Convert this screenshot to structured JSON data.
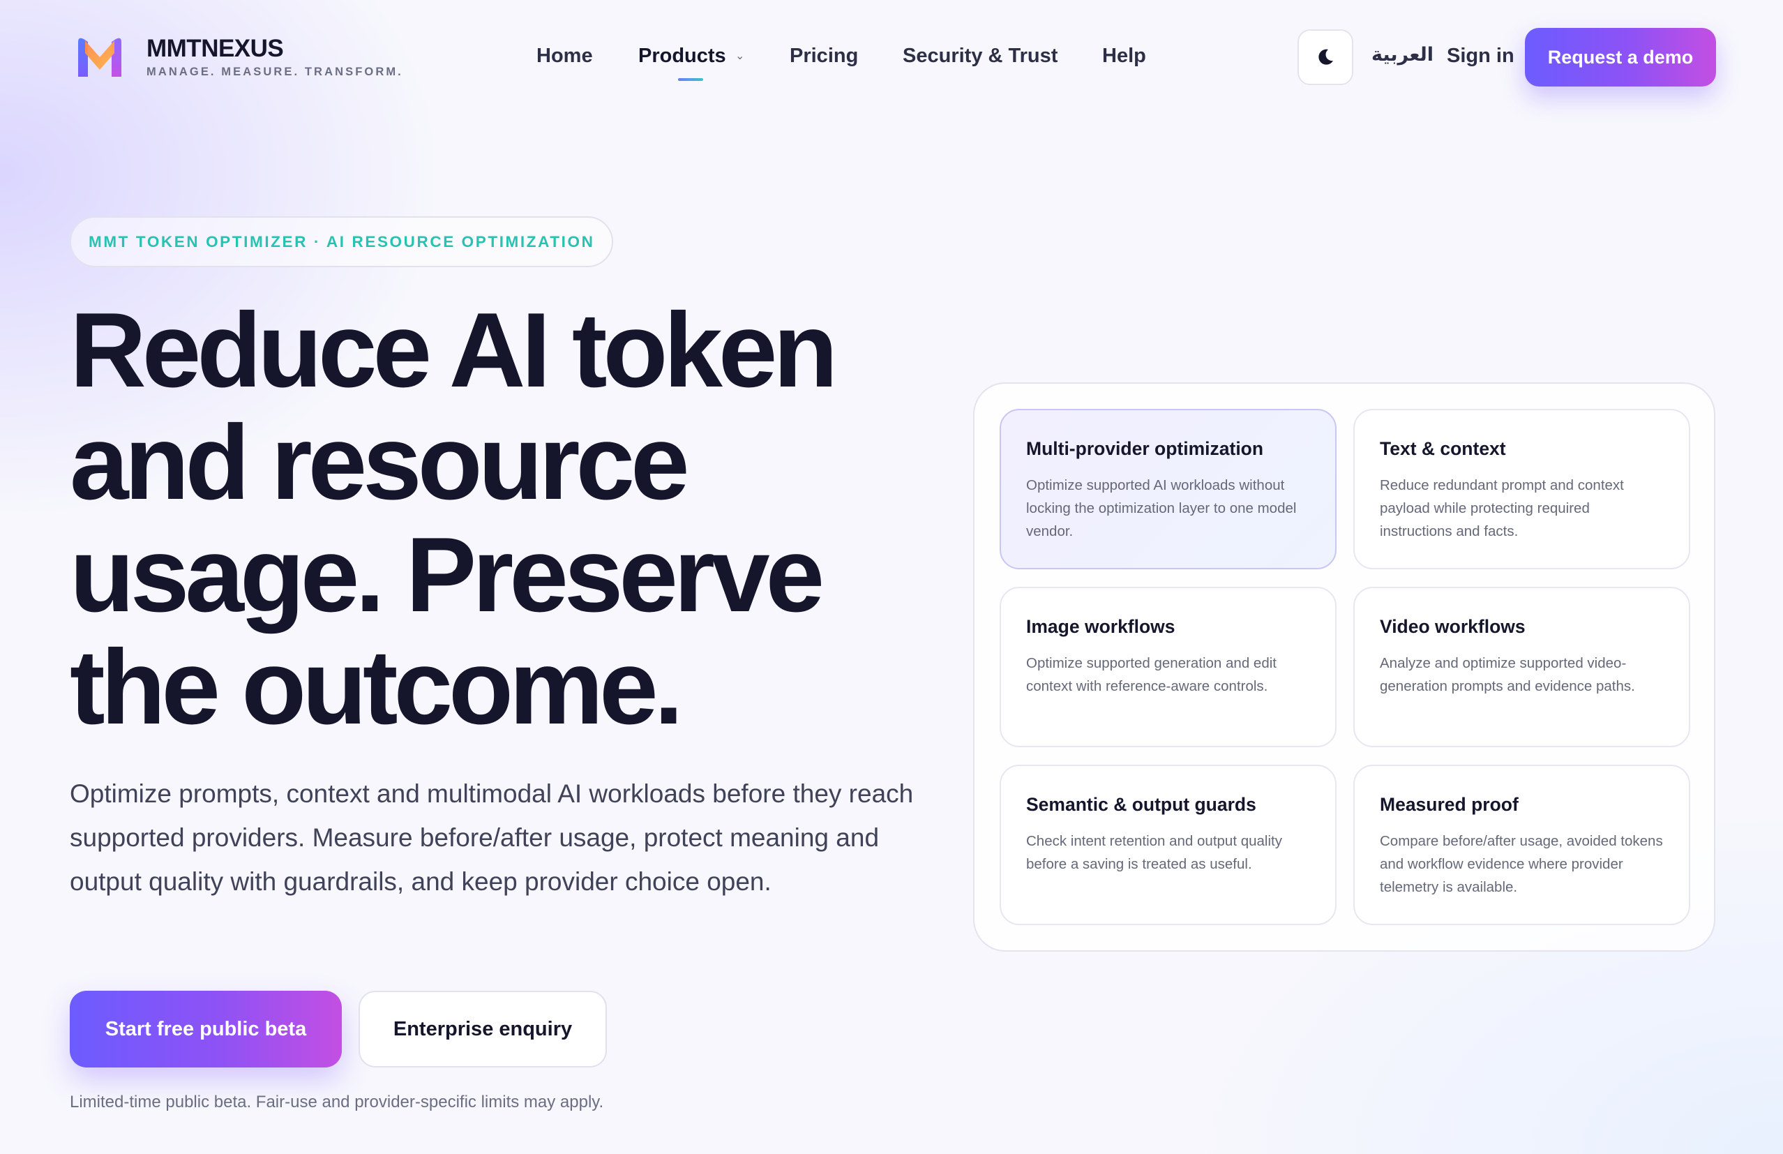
{
  "brand": {
    "name": "MMTNEXUS",
    "tagline": "MANAGE. MEASURE. TRANSFORM."
  },
  "nav": {
    "items": [
      {
        "label": "Home"
      },
      {
        "label": "Products",
        "active": true,
        "has_dropdown": true
      },
      {
        "label": "Pricing"
      },
      {
        "label": "Security & Trust"
      },
      {
        "label": "Help"
      }
    ],
    "caret": "⌄"
  },
  "header_actions": {
    "theme_icon": "moon-icon",
    "language": "العربية",
    "sign_in": "Sign in",
    "request_demo": "Request a demo"
  },
  "hero": {
    "eyebrow": "MMT TOKEN OPTIMIZER · AI RESOURCE OPTIMIZATION",
    "title_lines": [
      "Reduce AI token",
      "and resource",
      "usage. Preserve",
      "the outcome."
    ],
    "subtitle": "Optimize prompts, context and multimodal AI workloads before they reach supported providers. Measure before/after usage, protect meaning and output quality with guardrails, and keep provider choice open.",
    "primary_cta": "Start free public beta",
    "secondary_cta": "Enterprise enquiry",
    "note": "Limited-time public beta. Fair-use and provider-specific limits may apply."
  },
  "features": [
    {
      "title": "Multi-provider optimization",
      "description": "Optimize supported AI workloads without locking the optimization layer to one model vendor.",
      "highlighted": true
    },
    {
      "title": "Text & context",
      "description": "Reduce redundant prompt and context payload while protecting required instructions and facts."
    },
    {
      "title": "Image workflows",
      "description": "Optimize supported generation and edit context with reference-aware controls."
    },
    {
      "title": "Video workflows",
      "description": "Analyze and optimize supported video-generation prompts and evidence paths."
    },
    {
      "title": "Semantic & output guards",
      "description": "Check intent retention and output quality before a saving is treated as useful."
    },
    {
      "title": "Measured proof",
      "description": "Compare before/after usage, avoided tokens and workflow evidence where provider telemetry is available."
    }
  ],
  "colors": {
    "accent_start": "#6c5cff",
    "accent_end": "#c34fe3",
    "eyebrow_text": "#27c2b2",
    "heading": "#15162c"
  }
}
